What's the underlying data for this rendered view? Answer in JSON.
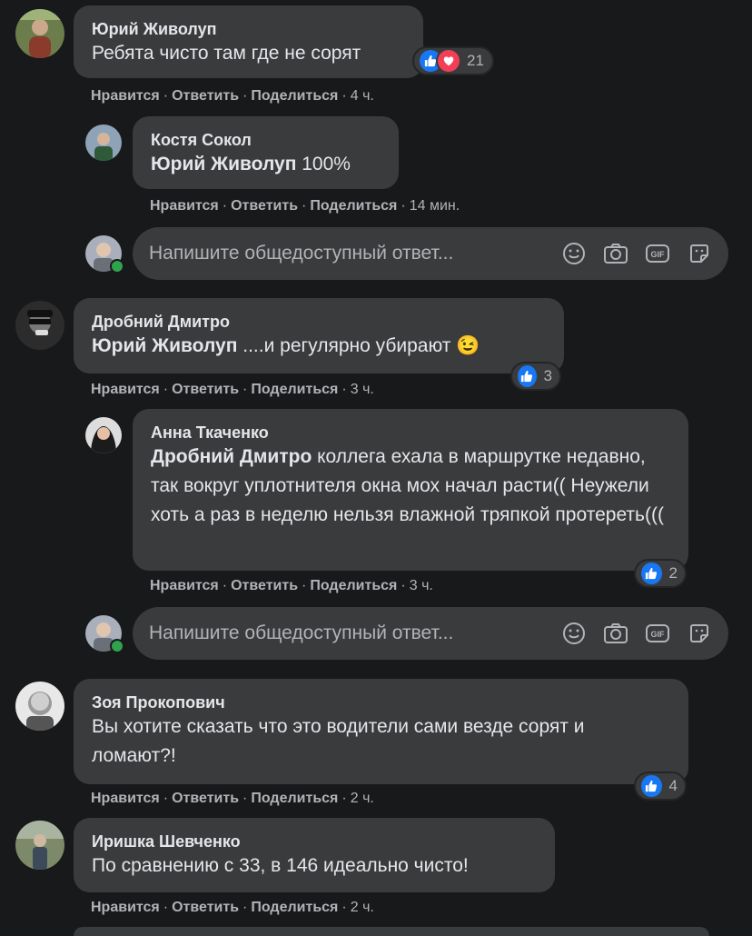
{
  "actions": {
    "like": "Нравится",
    "reply": "Ответить",
    "share": "Поделиться"
  },
  "comments": [
    {
      "author": "Юрий Живолуп",
      "text": "Ребята чисто там где не сорят",
      "reactions": {
        "icons": [
          "like-icon",
          "love-icon"
        ],
        "count": "21"
      },
      "time": "4 ч."
    },
    {
      "author": "Костя Сокол",
      "mention": "Юрий Живолуп",
      "text": " 100%",
      "time": "14 мин."
    },
    {
      "author": "Дробний Дмитро",
      "mention": "Юрий Живолуп",
      "text": " ....и регулярно убирают 😉",
      "reactions": {
        "icons": [
          "like-icon"
        ],
        "count": "3"
      },
      "time": "3 ч."
    },
    {
      "author": "Анна Ткаченко",
      "mention": "Дробний Дмитро",
      "text": " коллега ехала в маршрутке недавно, так вокруг уплотнителя окна мох начал расти(( Неужели хоть а раз в неделю нельзя влажной тряпкой протереть(((",
      "reactions": {
        "icons": [
          "like-icon"
        ],
        "count": "2"
      },
      "time": "3 ч."
    },
    {
      "author": "Зоя Прокопович",
      "text": "Вы хотите сказать что это водители сами везде сорят и ломают?!",
      "reactions": {
        "icons": [
          "like-icon"
        ],
        "count": "4"
      },
      "time": "2 ч."
    },
    {
      "author": "Иришка Шевченко",
      "text": "По сравнению с 33, в 146 идеально чисто!",
      "time": "2 ч."
    }
  ],
  "reply_box": {
    "placeholder": "Напишите общедоступный ответ...",
    "tools": [
      "emoji-icon",
      "camera-icon",
      "gif-icon",
      "sticker-icon"
    ]
  },
  "colors": {
    "background": "#18191a",
    "bubble": "#3a3b3c",
    "like": "#1877f2",
    "love": "#f33e58",
    "online": "#31a24c"
  }
}
